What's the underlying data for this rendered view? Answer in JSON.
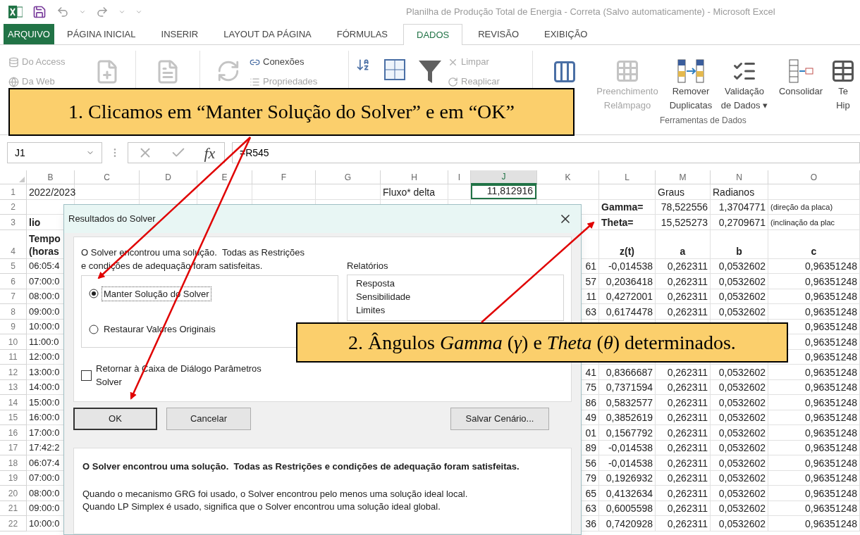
{
  "title_bar": {
    "title": "Planilha de Produção Total de Energia - Correta (Salvo automaticamente) - Microsoft Excel"
  },
  "tabs": [
    {
      "label": "ARQUIVO",
      "kind": "file",
      "selected": false
    },
    {
      "label": "PÁGINA INICIAL",
      "kind": "tab",
      "selected": false
    },
    {
      "label": "INSERIR",
      "kind": "tab",
      "selected": false
    },
    {
      "label": "LAYOUT DA PÁGINA",
      "kind": "tab",
      "selected": false
    },
    {
      "label": "FÓRMULAS",
      "kind": "tab",
      "selected": false
    },
    {
      "label": "DADOS",
      "kind": "tab",
      "selected": true
    },
    {
      "label": "REVISÃO",
      "kind": "tab",
      "selected": false
    },
    {
      "label": "EXIBIÇÃO",
      "kind": "tab",
      "selected": false
    }
  ],
  "ribbon": {
    "external": [
      {
        "label": "Do Access",
        "disabled": true
      },
      {
        "label": "Da Web",
        "disabled": true
      }
    ],
    "connections": [
      {
        "label": "Conexões",
        "disabled": false
      },
      {
        "label": "Propriedades",
        "disabled": true
      }
    ],
    "filter": [
      {
        "label": "Limpar",
        "disabled": true
      },
      {
        "label": "Reaplicar",
        "disabled": true
      }
    ],
    "data_tools": [
      {
        "lines": [
          "Preenchimento",
          "Relâmpago"
        ],
        "disabled": true
      },
      {
        "lines": [
          "Remover",
          "Duplicatas"
        ],
        "disabled": false
      },
      {
        "lines": [
          "Validação",
          "de Dados ▾"
        ],
        "disabled": false
      },
      {
        "lines": [
          "Consolidar"
        ],
        "disabled": false
      },
      {
        "lines": [
          "Te",
          "Hip"
        ],
        "disabled": false
      }
    ],
    "group_label": "Ferramentas de Dados"
  },
  "formula_bar": {
    "name_box": "J1",
    "function_label": "fx",
    "formula": "=R545"
  },
  "sheet": {
    "columns": [
      {
        "label": "B",
        "selected": false
      },
      {
        "label": "C",
        "selected": false
      },
      {
        "label": "D",
        "selected": false
      },
      {
        "label": "E",
        "selected": false
      },
      {
        "label": "F",
        "selected": false
      },
      {
        "label": "G",
        "selected": false
      },
      {
        "label": "H",
        "selected": false
      },
      {
        "label": "I",
        "selected": false
      },
      {
        "label": "J",
        "selected": true
      },
      {
        "label": "K",
        "selected": false
      },
      {
        "label": "L",
        "selected": false
      },
      {
        "label": "M",
        "selected": false
      },
      {
        "label": "N",
        "selected": false
      },
      {
        "label": "O",
        "selected": false
      }
    ],
    "rows": [
      {
        "number": "1",
        "kind": "data",
        "cells": [
          {
            "text": "2022/2023",
            "kind": "label"
          },
          null,
          null,
          null,
          null,
          null,
          {
            "text": "Fluxo* delta",
            "kind": "label"
          },
          null,
          {
            "text": "11,812916",
            "active": true
          },
          null,
          null,
          {
            "text": "Graus",
            "kind": "label"
          },
          {
            "text": "Radianos",
            "kind": "label"
          },
          null
        ]
      },
      {
        "number": "2",
        "kind": "data",
        "cells": [
          null,
          null,
          null,
          null,
          null,
          null,
          null,
          null,
          null,
          null,
          {
            "text": "Gamma=",
            "kind": "bold_label"
          },
          "78,522556",
          "1,3704771",
          {
            "text": "(direção da placa)",
            "kind": "note"
          }
        ]
      },
      {
        "number": "3",
        "kind": "data",
        "cells": [
          {
            "text": "lio",
            "kind": "bold_label"
          },
          null,
          null,
          null,
          null,
          null,
          null,
          null,
          null,
          null,
          {
            "text": "Theta=",
            "kind": "bold_label"
          },
          "15,525273",
          "0,2709671",
          {
            "text": "(inclinação da plac",
            "kind": "note"
          }
        ]
      },
      {
        "number": "4",
        "kind": "header",
        "cells": [
          {
            "text": "Tempo\n(horas",
            "kind": "bold_label"
          },
          null,
          null,
          null,
          null,
          null,
          null,
          null,
          null,
          null,
          {
            "text": "z(t)",
            "kind": "header"
          },
          {
            "text": "a",
            "kind": "header"
          },
          {
            "text": "b",
            "kind": "header"
          },
          {
            "text": "c",
            "kind": "header"
          }
        ]
      },
      {
        "number": "5",
        "kind": "data",
        "cells": [
          "06:05:4",
          null,
          null,
          null,
          null,
          null,
          null,
          null,
          null,
          "61",
          "-0,014538",
          "0,262311",
          "0,0532602",
          "0,96351248"
        ]
      },
      {
        "number": "6",
        "kind": "data",
        "cells": [
          "07:00:0",
          null,
          null,
          null,
          null,
          null,
          null,
          null,
          null,
          "57",
          "0,2036418",
          "0,262311",
          "0,0532602",
          "0,96351248"
        ]
      },
      {
        "number": "7",
        "kind": "data",
        "cells": [
          "08:00:0",
          null,
          null,
          null,
          null,
          null,
          null,
          null,
          null,
          "11",
          "0,4272001",
          "0,262311",
          "0,0532602",
          "0,96351248"
        ]
      },
      {
        "number": "8",
        "kind": "data",
        "cells": [
          "09:00:0",
          null,
          null,
          null,
          null,
          null,
          null,
          null,
          null,
          "63",
          "0,6174478",
          "0,262311",
          "0,0532602",
          "0,96351248"
        ]
      },
      {
        "number": "9",
        "kind": "data",
        "cells": [
          "10:00:0",
          null,
          null,
          null,
          null,
          null,
          null,
          null,
          null,
          null,
          null,
          null,
          null,
          "0,96351248"
        ]
      },
      {
        "number": "10",
        "kind": "data",
        "cells": [
          "11:00:0",
          null,
          null,
          null,
          null,
          null,
          null,
          null,
          null,
          null,
          null,
          null,
          null,
          "0,96351248"
        ]
      },
      {
        "number": "11",
        "kind": "data",
        "cells": [
          "12:00:0",
          null,
          null,
          null,
          null,
          null,
          null,
          null,
          null,
          null,
          null,
          null,
          null,
          "0,96351248"
        ]
      },
      {
        "number": "12",
        "kind": "data",
        "cells": [
          "13:00:0",
          null,
          null,
          null,
          null,
          null,
          null,
          null,
          null,
          "41",
          "0,8366687",
          "0,262311",
          "0,0532602",
          "0,96351248"
        ]
      },
      {
        "number": "13",
        "kind": "data",
        "cells": [
          "14:00:0",
          null,
          null,
          null,
          null,
          null,
          null,
          null,
          null,
          "75",
          "0,7371594",
          "0,262311",
          "0,0532602",
          "0,96351248"
        ]
      },
      {
        "number": "14",
        "kind": "data",
        "cells": [
          "15:00:0",
          null,
          null,
          null,
          null,
          null,
          null,
          null,
          null,
          "86",
          "0,5832577",
          "0,262311",
          "0,0532602",
          "0,96351248"
        ]
      },
      {
        "number": "15",
        "kind": "data",
        "cells": [
          "16:00:0",
          null,
          null,
          null,
          null,
          null,
          null,
          null,
          null,
          "49",
          "0,3852619",
          "0,262311",
          "0,0532602",
          "0,96351248"
        ]
      },
      {
        "number": "16",
        "kind": "data",
        "cells": [
          "17:00:0",
          null,
          null,
          null,
          null,
          null,
          null,
          null,
          null,
          "01",
          "0,1567792",
          "0,262311",
          "0,0532602",
          "0,96351248"
        ]
      },
      {
        "number": "17",
        "kind": "data",
        "cells": [
          "17:42:2",
          null,
          null,
          null,
          null,
          null,
          null,
          null,
          null,
          "89",
          "-0,014538",
          "0,262311",
          "0,0532602",
          "0,96351248"
        ]
      },
      {
        "number": "18",
        "kind": "data",
        "cells": [
          "06:07:4",
          null,
          null,
          null,
          null,
          null,
          null,
          null,
          null,
          "56",
          "-0,014538",
          "0,262311",
          "0,0532602",
          "0,96351248"
        ]
      },
      {
        "number": "19",
        "kind": "data",
        "cells": [
          "07:00:0",
          null,
          null,
          null,
          null,
          null,
          null,
          null,
          null,
          "79",
          "0,1926932",
          "0,262311",
          "0,0532602",
          "0,96351248"
        ]
      },
      {
        "number": "20",
        "kind": "data",
        "cells": [
          "08:00:0",
          null,
          null,
          null,
          null,
          null,
          null,
          null,
          null,
          "65",
          "0,4132634",
          "0,262311",
          "0,0532602",
          "0,96351248"
        ]
      },
      {
        "number": "21",
        "kind": "data",
        "cells": [
          "09:00:0",
          null,
          null,
          null,
          null,
          null,
          null,
          null,
          null,
          "63",
          "0,6005598",
          "0,262311",
          "0,0532602",
          "0,96351248"
        ]
      },
      {
        "number": "22",
        "kind": "data",
        "cells": [
          "10:00:0",
          null,
          null,
          null,
          null,
          null,
          null,
          null,
          null,
          "36",
          "0,7420928",
          "0,262311",
          "0,0532602",
          "0,96351248"
        ]
      }
    ]
  },
  "dialog": {
    "title": "Resultados do Solver",
    "message_lines": [
      "O Solver encontrou uma solução.  Todas as Restrições",
      "e condições de adequação foram satisfeitas."
    ],
    "options": [
      {
        "label": "Manter Solução do Solver",
        "selected": true
      },
      {
        "label": "Restaurar Valores Originais",
        "selected": false
      }
    ],
    "return_checkbox": {
      "label_lines": [
        "Retornar à Caixa de Diálogo Parâmetros",
        "Solver"
      ],
      "checked": false
    },
    "reports_label": "Relatórios",
    "reports": [
      "Resposta",
      "Sensibilidade",
      "Limites"
    ],
    "buttons": [
      {
        "label": "OK",
        "default": true
      },
      {
        "label": "Cancelar",
        "default": false
      },
      {
        "label": "Salvar Cenário...",
        "default": false
      }
    ],
    "result_title": "O Solver encontrou uma solução.  Todas as Restrições e condições de adequação foram satisfeitas.",
    "result_lines": [
      "Quando o mecanismo GRG foi usado, o Solver encontrou pelo menos uma solução ideal local.",
      "Quando LP Simplex é usado, significa que o Solver encontrou uma solução ideal global."
    ]
  },
  "callouts": [
    {
      "text": "1. Clicamos em “Manter Solução do Solver” e em “OK”"
    },
    {
      "text": "2. Ângulos *Gamma* (*γ*) e *Theta* (*θ*) determinados."
    }
  ]
}
